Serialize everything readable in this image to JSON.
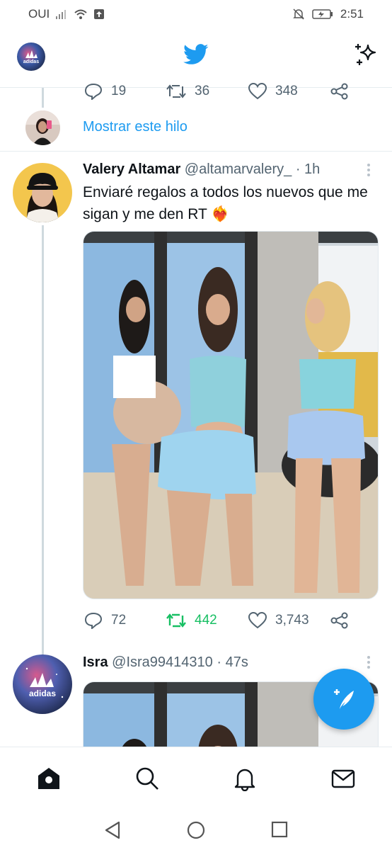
{
  "status_bar": {
    "carrier": "OUI",
    "time": "2:51"
  },
  "header": {
    "title_icon": "twitter-bird-icon",
    "right_icon": "sparkle-icon"
  },
  "previous_tweet_actions": {
    "replies": "19",
    "retweets": "36",
    "likes": "348"
  },
  "show_thread": {
    "label": "Mostrar este hilo"
  },
  "tweets": [
    {
      "name": "Valery Altamar",
      "handle": "@altamarvalery_",
      "time": "· 1h",
      "text": "Enviaré regalos a todos los nuevos que me sigan y me den RT",
      "emoji": "❤️‍🔥",
      "replies": "72",
      "retweets": "442",
      "likes": "3,743",
      "colors": {
        "retweet_active": "#17bf63"
      }
    },
    {
      "name": "Isra",
      "handle": "@Isra99414310",
      "time": "· 47s"
    }
  ],
  "avatar_text": {
    "brand": "adidas"
  },
  "bottom_nav": {
    "items": [
      "home-icon",
      "search-icon",
      "notifications-icon",
      "messages-icon"
    ]
  },
  "colors": {
    "accent": "#1d9bf0",
    "secondary_text": "#536471",
    "thread_line": "#cfd9de"
  }
}
